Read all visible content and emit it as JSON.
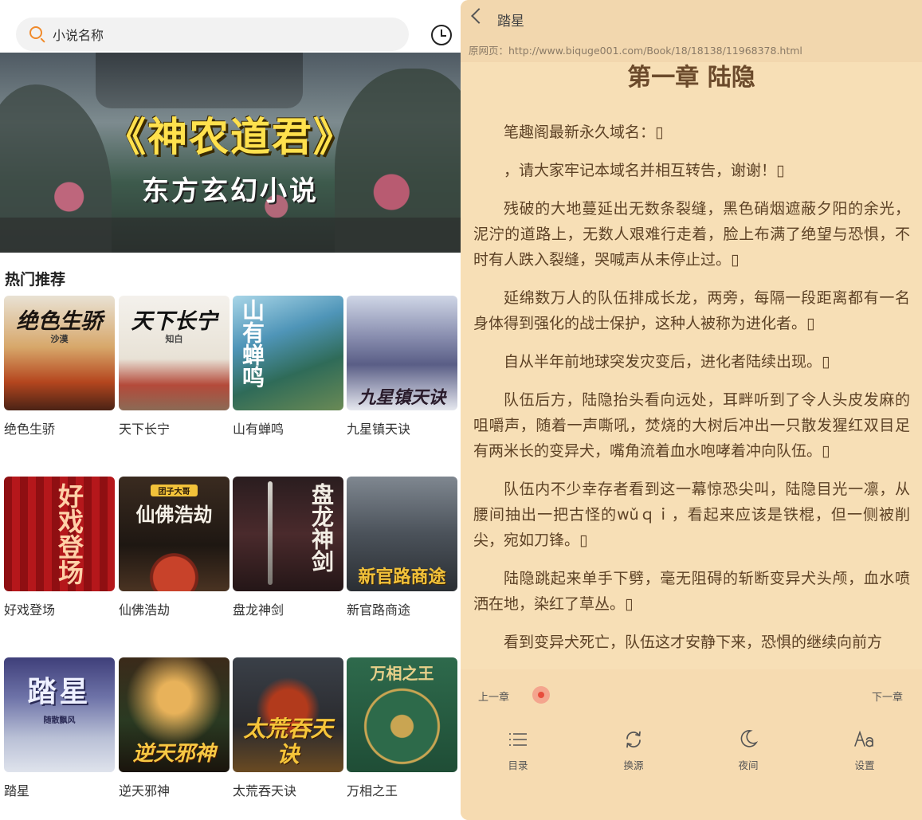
{
  "left": {
    "search": {
      "placeholder": "小说名称"
    },
    "banner": {
      "title": "《神农道君》",
      "subtitle": "东方玄幻小说"
    },
    "section_title": "热门推荐",
    "books": [
      {
        "title": "绝色生骄",
        "cover_text": "绝色生骄",
        "cover_author": "沙漠"
      },
      {
        "title": "天下长宁",
        "cover_text": "天下长宁",
        "cover_author": "知白"
      },
      {
        "title": "山有蝉鸣",
        "cover_text": "山有蝉鸣",
        "cover_author": ""
      },
      {
        "title": "九星镇天诀",
        "cover_text": "九星镇天诀",
        "cover_author": ""
      },
      {
        "title": "好戏登场",
        "cover_text": "好戏登场",
        "cover_author": ""
      },
      {
        "title": "仙佛浩劫",
        "cover_text": "仙佛浩劫",
        "cover_author": "团子大哥"
      },
      {
        "title": "盘龙神剑",
        "cover_text": "盘龙神剑",
        "cover_author": ""
      },
      {
        "title": "新官路商途",
        "cover_text": "新官路商途",
        "cover_author": ""
      },
      {
        "title": "踏星",
        "cover_text": "踏星",
        "cover_author": "随散飘风"
      },
      {
        "title": "逆天邪神",
        "cover_text": "逆天邪神",
        "cover_author": ""
      },
      {
        "title": "太荒吞天诀",
        "cover_text": "太荒吞天诀",
        "cover_author": ""
      },
      {
        "title": "万相之王",
        "cover_text": "万相之王",
        "cover_author": ""
      }
    ]
  },
  "right": {
    "book_name": "踏星",
    "source_url": "原网页：http://www.biquge001.com/Book/18/18138/11968378.html",
    "chapter_title": "第一章 陆隐",
    "paragraphs": [
      "笔趣阁最新永久域名：▯",
      "，请大家牢记本域名并相互转告，谢谢！▯",
      "残破的大地蔓延出无数条裂缝，黑色硝烟遮蔽夕阳的余光，泥泞的道路上，无数人艰难行走着，脸上布满了绝望与恐惧，不时有人跌入裂缝，哭喊声从未停止过。▯",
      "延绵数万人的队伍排成长龙，两旁，每隔一段距离都有一名身体得到强化的战士保护，这种人被称为进化者。▯",
      "自从半年前地球突发灾变后，进化者陆续出现。▯",
      "队伍后方，陆隐抬头看向远处，耳畔听到了令人头皮发麻的咀嚼声，随着一声嘶吼，焚烧的大树后冲出一只散发猩红双目足有两米长的变异犬，嘴角流着血水咆哮着冲向队伍。▯",
      "队伍内不少幸存者看到这一幕惊恐尖叫，陆隐目光一凛，从腰间抽出一把古怪的wǔｑｉ，看起来应该是铁棍，但一侧被削尖，宛如刀锋。▯",
      "陆隐跳起来单手下劈，毫无阻碍的斩断变异犬头颅，血水喷洒在地，染红了草丛。▯",
      "看到变异犬死亡，队伍这才安静下来，恐惧的继续向前方"
    ],
    "prev_chapter": "上一章",
    "next_chapter": "下一章",
    "reading_progress": 0.0,
    "menu": [
      {
        "label": "目录",
        "icon": "list-icon"
      },
      {
        "label": "换源",
        "icon": "refresh-icon"
      },
      {
        "label": "夜间",
        "icon": "moon-icon"
      },
      {
        "label": "设置",
        "icon": "font-settings-icon"
      }
    ]
  },
  "colors": {
    "accent": "#f08a2a",
    "reader_bg": "#f7dfb6",
    "reader_text": "#5d4226",
    "progress": "#e84d3c"
  }
}
